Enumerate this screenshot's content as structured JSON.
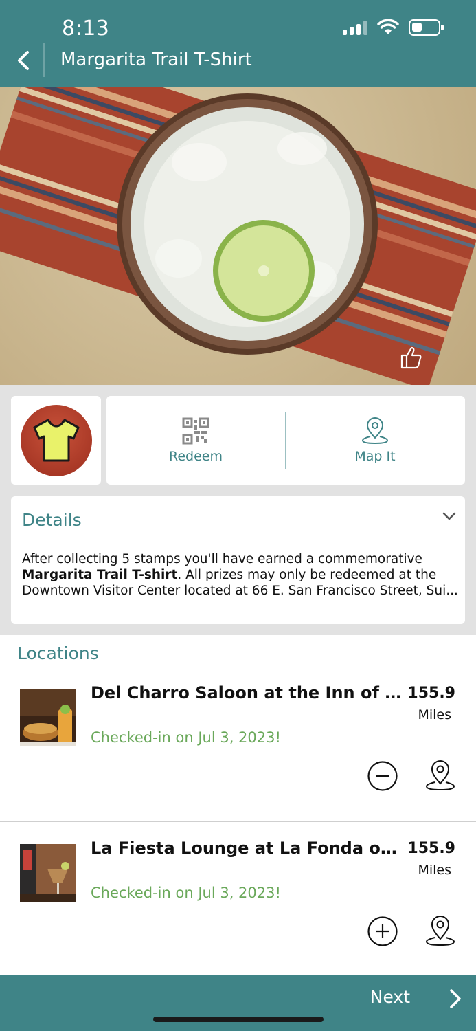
{
  "status_bar": {
    "time": "8:13"
  },
  "header": {
    "title": "Margarita Trail T-Shirt"
  },
  "hero": {
    "icon": "thumbs-up-icon"
  },
  "reward": {
    "icon": "tshirt-icon"
  },
  "actions": {
    "redeem_label": "Redeem",
    "map_label": "Map It"
  },
  "details": {
    "title": "Details",
    "text_before": "After collecting 5 stamps you'll have earned a commemorative ",
    "text_bold": "Margarita Trail T-shirt",
    "text_after": ". All prizes may only be redeemed at the Downtown Visitor Center located at 66 E. San Francisco Street, Sui..."
  },
  "locations": {
    "heading": "Locations",
    "items": [
      {
        "name": "Del Charro Saloon at the Inn of th...",
        "distance": "155.9",
        "unit": "Miles",
        "status": "Checked-in on Jul 3, 2023!",
        "action_icon": "minus-circle-icon"
      },
      {
        "name": "La Fiesta Lounge at La Fonda on t...",
        "distance": "155.9",
        "unit": "Miles",
        "status": "Checked-in on Jul 3, 2023!",
        "action_icon": "plus-circle-icon"
      }
    ]
  },
  "footer": {
    "next_label": "Next"
  },
  "colors": {
    "brand_teal": "#3f8487",
    "checked_in_green": "#6aa85a"
  }
}
